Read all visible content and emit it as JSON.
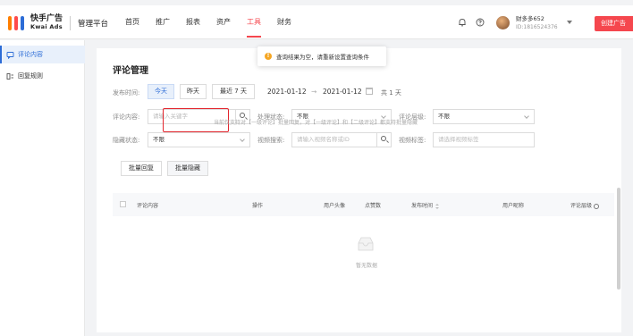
{
  "header": {
    "logo_cn": "快手广告",
    "logo_en": "Kwai Ads",
    "platform": "管理平台",
    "nav": [
      "首页",
      "推广",
      "报表",
      "资产",
      "工具",
      "财务"
    ],
    "active_nav": "工具",
    "user_name": "财多多652",
    "user_id": "ID:1816524376",
    "create_button": "创建广告",
    "brand_colors": [
      "#ff7e00",
      "#ff4b4b",
      "#2c6cd6"
    ]
  },
  "sidebar": {
    "items": [
      {
        "label": "评论内容",
        "icon": "comment-icon",
        "active": true
      },
      {
        "label": "回复规则",
        "icon": "reply-rules-icon",
        "active": false
      }
    ]
  },
  "toast": {
    "icon": "warning-icon",
    "text": "查询结果为空，请重新设置查询条件"
  },
  "page": {
    "title": "评论管理",
    "publish_time_label": "发布时间:",
    "date_buttons": [
      "今天",
      "昨天",
      "最近 7 天"
    ],
    "date_start": "2021-01-12",
    "date_sep": "→",
    "date_end": "2021-01-12",
    "date_days": "共 1 天",
    "comment_content_label": "评论内容:",
    "comment_content_placeholder": "请输入关键字",
    "process_status_label": "处理状态:",
    "process_status_value": "不限",
    "comment_level_label": "评论层级:",
    "comment_level_value": "不限",
    "hidden_status_label": "隐藏状态:",
    "hidden_status_value": "不限",
    "video_search_label": "视频搜索:",
    "video_search_placeholder": "请输入视频名称或ID",
    "video_tag_label": "视频标签:",
    "video_tag_placeholder": "请选择视频标签",
    "tabs": [
      "批量回复",
      "批量隐藏"
    ],
    "tab_note": "当前仅支持对【一级评论】批量回复，对【一级评论】和【二级评论】都支持批量隐藏"
  },
  "table": {
    "columns": [
      "评论内容",
      "操作",
      "用户头像",
      "点赞数",
      "发布时间",
      "用户昵称",
      "评论层级"
    ],
    "empty_text": "暂无数据",
    "rows": []
  }
}
